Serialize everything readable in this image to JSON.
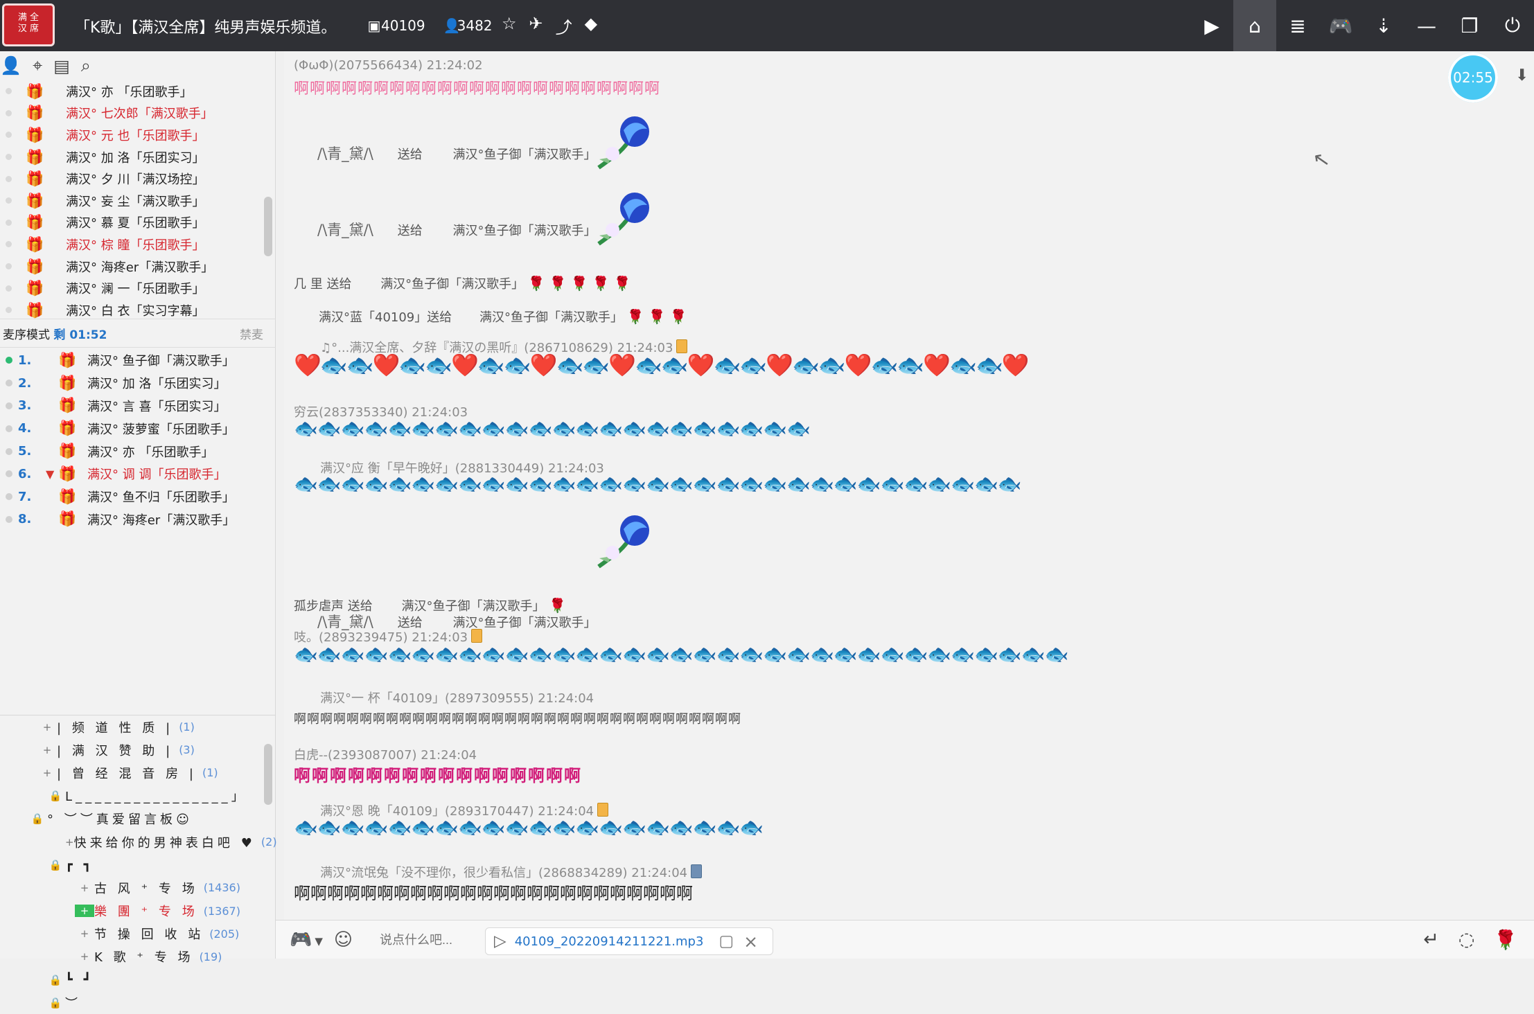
{
  "header": {
    "logo_text": "满\n全\n汉\n席",
    "title": "「K歌」【满汉全席】纯男声娱乐频道。",
    "channel_id": "40109",
    "online_count": "3482"
  },
  "left": {
    "members": [
      {
        "name": "满汉°  亦  「乐团歌手」",
        "red": false
      },
      {
        "name": "满汉° 七次郎「满汉歌手」",
        "red": true
      },
      {
        "name": "满汉° 元  也「乐团歌手」",
        "red": true
      },
      {
        "name": "满汉° 加  洛「乐团实习」",
        "red": false
      },
      {
        "name": "满汉° 夕  川「满汉场控」",
        "red": false
      },
      {
        "name": "满汉° 妄  尘「满汉歌手」",
        "red": false
      },
      {
        "name": "满汉° 慕  夏「乐团歌手」",
        "red": false
      },
      {
        "name": "满汉° 棕  瞳「乐团歌手」",
        "red": true
      },
      {
        "name": "满汉° 海疼er「满汉歌手」",
        "red": false
      },
      {
        "name": "满汉° 澜  一「乐团歌手」",
        "red": false
      },
      {
        "name": "满汉° 白  衣「实习字幕」",
        "red": false
      }
    ],
    "mode_label": "麦序模式",
    "mode_remaining": "剩 01:52",
    "mode_action": "禁麦",
    "queue": [
      {
        "num": "1.",
        "name": "满汉° 鱼子御「满汉歌手」",
        "red": false,
        "v": false,
        "active": true
      },
      {
        "num": "2.",
        "name": "满汉° 加  洛「乐团实习」",
        "red": false,
        "v": false,
        "active": false
      },
      {
        "num": "3.",
        "name": "满汉° 言  喜「乐团实习」",
        "red": false,
        "v": false,
        "active": false
      },
      {
        "num": "4.",
        "name": "满汉° 菠萝蜜「乐团歌手」",
        "red": false,
        "v": false,
        "active": false
      },
      {
        "num": "5.",
        "name": "满汉°  亦  「乐团歌手」",
        "red": false,
        "v": false,
        "active": false
      },
      {
        "num": "6.",
        "name": "满汉° 调  调「乐团歌手」",
        "red": true,
        "v": true,
        "active": false
      },
      {
        "num": "7.",
        "name": "满汉° 鱼不归「乐团歌手」",
        "red": false,
        "v": false,
        "active": false
      },
      {
        "num": "8.",
        "name": "满汉° 海疼er「满汉歌手」",
        "red": false,
        "v": false,
        "active": false
      }
    ],
    "channels": [
      {
        "side": "+",
        "name": "|  频 道 性 质  |",
        "count": "(1)",
        "green": false
      },
      {
        "side": "+",
        "name": "|  满 汉 赞 助  |",
        "count": "(3)",
        "green": false
      },
      {
        "side": "+",
        "name": "|  曾 经 混 音 房  |",
        "count": "(1)",
        "green": false
      },
      {
        "side": "lock",
        "name": "L________________」",
        "count": "",
        "green": false
      },
      {
        "side": "lock",
        "name": "° ︶︶真爱留言板☺",
        "count": "",
        "green": false
      },
      {
        "side": "+",
        "name": "快来给你的男神表白吧 ♥",
        "count": "(2)",
        "green": false
      },
      {
        "side": "lock",
        "name": "┏                            ┓",
        "count": "",
        "green": false
      },
      {
        "side": "+",
        "name": "古 风 ⁺ 专 场",
        "count": "(1436)",
        "green": false
      },
      {
        "side": "+",
        "name": "樂 團 ⁺ 专 场",
        "count": "(1367)",
        "green": true
      },
      {
        "side": "+",
        "name": "节 操 回 收 站",
        "count": "(205)",
        "green": false
      },
      {
        "side": "+",
        "name": "K 歌 ⁺ 专 场",
        "count": "(19)",
        "green": false
      },
      {
        "side": "lock",
        "name": "┗                            ┛",
        "count": "",
        "green": false
      },
      {
        "side": "lock",
        "name": "︶",
        "count": "",
        "green": false
      }
    ]
  },
  "chat": {
    "timer": "02:55",
    "messages": {
      "m1_meta": "(ΦωΦ)(2075566434)  21:24:02",
      "m1_text": "啊啊啊啊啊啊啊啊啊啊啊啊啊啊啊啊啊啊啊啊啊啊啊",
      "g1_from": "/\\青_黛/\\",
      "g1_send": "送给",
      "g1_to": "满汉°鱼子御「满汉歌手」",
      "g2_from": "/\\青_黛/\\",
      "g2_send": "送给",
      "g2_to": "满汉°鱼子御「满汉歌手」",
      "g3_line": "几 里 送给",
      "g3_to": "满汉°鱼子御「满汉歌手」",
      "g4_from": "满汉°蓝「40109」送给",
      "g4_to": "满汉°鱼子御「满汉歌手」",
      "m2_meta": "♫°...满汉全席、夕辞『满汉の黑听』(2867108629)  21:24:03",
      "m3_meta": "穷云(2837353340)  21:24:03",
      "m4_meta": "满汉°应    衡「早午晚好」(2881330449)  21:24:03",
      "g5_from": "/\\青_黛/\\",
      "g5_send": "送给",
      "g5_to": "满汉°鱼子御「满汉歌手」",
      "g6_from": "孤步虐声 送给",
      "g6_to": "满汉°鱼子御「满汉歌手」",
      "m5_meta": "吱。(2893239475)  21:24:03",
      "m6_meta": "满汉°一    杯「40109」(2897309555)  21:24:04",
      "m6_text": "啊啊啊啊啊啊啊啊啊啊啊啊啊啊啊啊啊啊啊啊啊啊啊啊啊啊啊啊啊啊啊啊啊啊",
      "m7_meta": "白虎--(2393087007)  21:24:04",
      "m7_text": "啊啊啊啊啊啊啊啊啊啊啊啊啊啊啊啊",
      "m8_meta": "满汉°恩    晚「40109」(2893170447)  21:24:04",
      "m9_meta": "满汉°流氓兔「没不理你，很少看私信」(2868834289)  21:24:04",
      "m9_text": "啊啊啊啊啊啊啊啊啊啊啊啊啊啊啊啊啊啊啊啊啊啊啊啊"
    }
  },
  "input": {
    "placeholder": "说点什么吧...",
    "file_name": "40109_20220914211221.mp3"
  },
  "icons": {
    "user": "user-icon",
    "location": "location-icon",
    "notes": "notes-icon",
    "search": "search-icon",
    "gift": "gift-icon",
    "home": "home-icon",
    "game": "game-icon",
    "heart": "heart-icon",
    "fish": "fish-icon",
    "rose": "rose-icon"
  }
}
